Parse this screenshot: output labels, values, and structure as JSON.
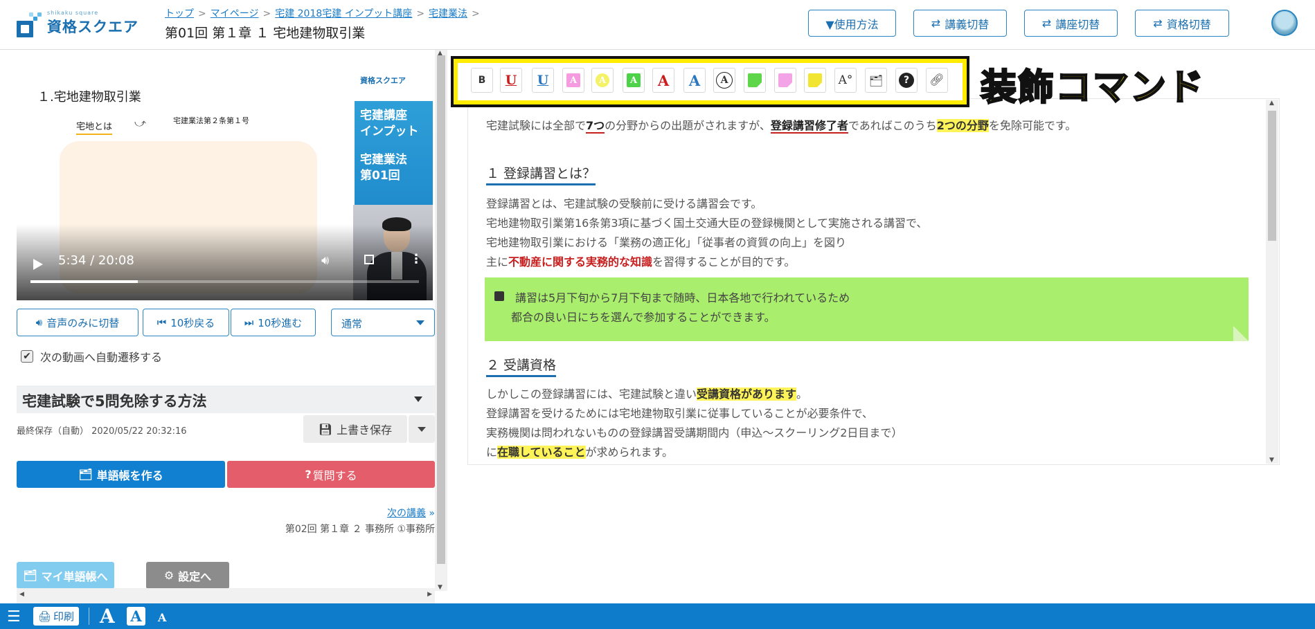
{
  "header": {
    "logo_sub": "shikaku square",
    "logo_text": "資格スクエア",
    "breadcrumb": [
      "トップ",
      "マイページ",
      "宅建 2018宅建 インプット講座",
      "宅建業法"
    ],
    "breadcrumb_tail": ">",
    "title": "第01回 第１章 １ 宅地建物取引業",
    "buttons": {
      "usage": "▼使用方法",
      "lecture_switch": "講義切替",
      "course_switch": "講座切替",
      "qualification_switch": "資格切替"
    }
  },
  "video": {
    "slide_title": "１.宅地建物取引業",
    "slide_label": "宅地とは",
    "slide_ref": "宅建業法第２条第１号",
    "brand_logo": "資格スクエア",
    "brand_line1a": "宅建講座",
    "brand_line1b": "インプット",
    "brand_line2a": "宅建業法",
    "brand_line2b": "第01回",
    "time": "5:34 / 20:08",
    "progress": 0.277
  },
  "controls": {
    "audio_only": "音声のみに切替",
    "back10": "10秒戻る",
    "fwd10": "10秒進む",
    "speed": "通常",
    "autonext": "次の動画へ自動遷移する",
    "autonext_checked": true
  },
  "note": {
    "title": "宅建試験で5問免除する方法",
    "last_saved": "最終保存（自動） 2020/05/22 20:32:16",
    "save_label": "上書き保存",
    "flashcard_btn": "単語帳を作る",
    "question_btn": "質問する",
    "next_label": "次の講義",
    "next_title": "第02回 第１章 ２ 事務所 ①事務所",
    "my_flashcards": "マイ単語帳へ",
    "settings": "設定へ"
  },
  "toolbar": {
    "label": "装飾コマンド",
    "tools": [
      "bold",
      "underline-red",
      "underline-blue",
      "highlight-pink",
      "highlight-yellow",
      "highlight-green",
      "text-red",
      "text-blue",
      "circle-a",
      "sticky-green",
      "sticky-pink",
      "sticky-yellow",
      "font-size",
      "flashcard",
      "question",
      "link"
    ]
  },
  "content": {
    "p1_a": "宅建試験には全部で",
    "p1_b": "7つ",
    "p1_c": "の分野からの出題がされますが、",
    "p1_d": "登録講習修了者",
    "p1_e": "であればこのうち",
    "p1_f": "2つの分野",
    "p1_g": "を免除可能です。",
    "h1": "１ 登録講習とは？",
    "s1_l1": "登録講習とは、宅建試験の受験前に受ける講習会です。",
    "s1_l2": "宅地建物取引業第16条第3項に基づく国土交通大臣の登録機関として実施される講習で、",
    "s1_l3": "宅地建物取引業における「業務の適正化」「従事者の資質の向上」を図り",
    "s1_l4a": "主に",
    "s1_l4b": "不動産に関する実務的な知識",
    "s1_l4c": "を習得することが目的です。",
    "memo_l1": "講習は5月下旬から7月下旬まで随時、日本各地で行われているため",
    "memo_l2": "都合の良い日にちを選んで参加することができます。",
    "h2": "２ 受講資格",
    "s2_l1a": "しかしこの登録講習には、宅建試験と違い",
    "s2_l1b": "受講資格があります",
    "s2_l1c": "。",
    "s2_l2": "登録講習を受けるためには宅地建物取引業に従事していることが必要条件で、",
    "s2_l3": "実務機関は問われないものの登録講習受講期間内（申込～スクーリング2日目まで）",
    "s2_l4a": "に",
    "s2_l4b": "在職していること",
    "s2_l4c": "が求められます。"
  },
  "footer": {
    "print": "印刷",
    "a_large": "A",
    "a_medium": "A",
    "a_small": "A"
  },
  "colors": {
    "primary": "#0f7bcb",
    "flashcard_btn": "#1180d0",
    "question_btn": "#e35d6a",
    "my_flashcards_btn": "#82ccf0",
    "settings_btn": "#8c8c8c",
    "highlight_yellow": "#fff35a",
    "memo_green": "#a9ee6c",
    "accent_red": "#c81e1e"
  }
}
